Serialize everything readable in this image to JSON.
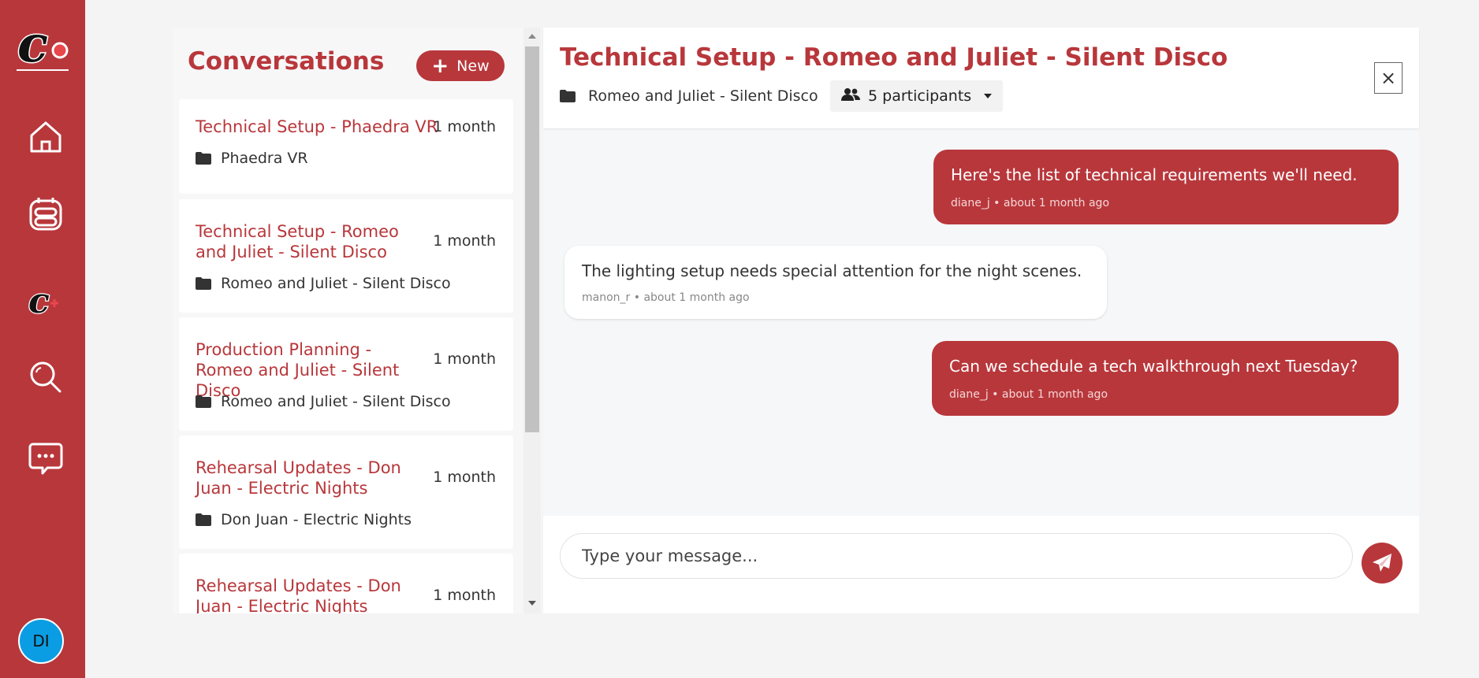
{
  "sidebar": {
    "avatar_initials": "DI",
    "icons": [
      "home-icon",
      "calendar-icon",
      "logo-add-icon",
      "search-icon",
      "chat-icon"
    ]
  },
  "conversations": {
    "title": "Conversations",
    "new_label": "New",
    "items": [
      {
        "title": "Technical Setup - Phaedra VR",
        "age": "1 month",
        "project": "Phaedra VR"
      },
      {
        "title": "Technical Setup - Romeo and Juliet - Silent Disco",
        "age": "1 month",
        "project": "Romeo and Juliet - Silent Disco"
      },
      {
        "title": "Production Planning - Romeo and Juliet - Silent Disco",
        "age": "1 month",
        "project": "Romeo and Juliet - Silent Disco"
      },
      {
        "title": "Rehearsal Updates - Don Juan - Electric Nights",
        "age": "1 month",
        "project": "Don Juan - Electric Nights"
      },
      {
        "title": "Rehearsal Updates - Don Juan - Electric Nights",
        "age": "1 month",
        "project": ""
      }
    ]
  },
  "chat": {
    "title": "Technical Setup - Romeo and Juliet - Silent Disco",
    "project": "Romeo and Juliet - Silent Disco",
    "participants": "5 participants",
    "close_label": "×",
    "messages": [
      {
        "text": "Here's the list of technical requirements we'll need.",
        "meta": "diane_j • about 1 month ago",
        "direction": "out"
      },
      {
        "text": "The lighting setup needs special attention for the night scenes.",
        "meta": "manon_r • about 1 month ago",
        "direction": "in"
      },
      {
        "text": "Can we schedule a tech walkthrough next Tuesday?",
        "meta": "diane_j • about 1 month ago",
        "direction": "out"
      }
    ],
    "input_placeholder": "Type your message..."
  },
  "colors": {
    "brand": "#b8373b",
    "avatar": "#0b9de3"
  }
}
